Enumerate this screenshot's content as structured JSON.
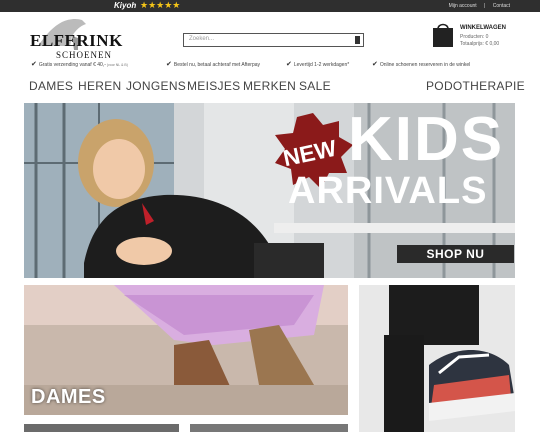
{
  "topbar": {
    "kiyoh_label": "Kiyoh",
    "stars": "★★★★★",
    "links": [
      "Mijn account",
      "|",
      "Contact"
    ]
  },
  "logo": {
    "line1": "ELFERINK",
    "line2": "SCHOENEN"
  },
  "search": {
    "placeholder": "Zoeken..."
  },
  "cart": {
    "title": "WINKELWAGEN",
    "products": "Producten: 0",
    "total": "Totaalprijs: € 0,00",
    "icon": "shopping-bag-icon"
  },
  "usps": [
    {
      "text": "Gratis verzending vanaf € 40,-",
      "small": " (voor NL & B)"
    },
    {
      "text": "Bestel nu, betaal achteraf met Afterpay",
      "small": ""
    },
    {
      "text": "Levertijd 1-2 werkdagen*",
      "small": ""
    },
    {
      "text": "Online schoenen reserveren in de winkel",
      "small": ""
    }
  ],
  "nav": {
    "items": [
      "DAMES",
      "HEREN",
      "JONGENS",
      "MEISJES",
      "MERKEN",
      "SALE"
    ],
    "right": "PODOTHERAPIE"
  },
  "hero": {
    "new": "NEW",
    "kids": "KIDS",
    "arrivals": "ARRIVALS",
    "cta": "SHOP NU"
  },
  "tiles": {
    "dames": "DAMES"
  },
  "colors": {
    "topbar": "#2f2f2f",
    "badge": "#8b1a1a",
    "cta": "#2a2a2a",
    "star": "#f5c518"
  }
}
